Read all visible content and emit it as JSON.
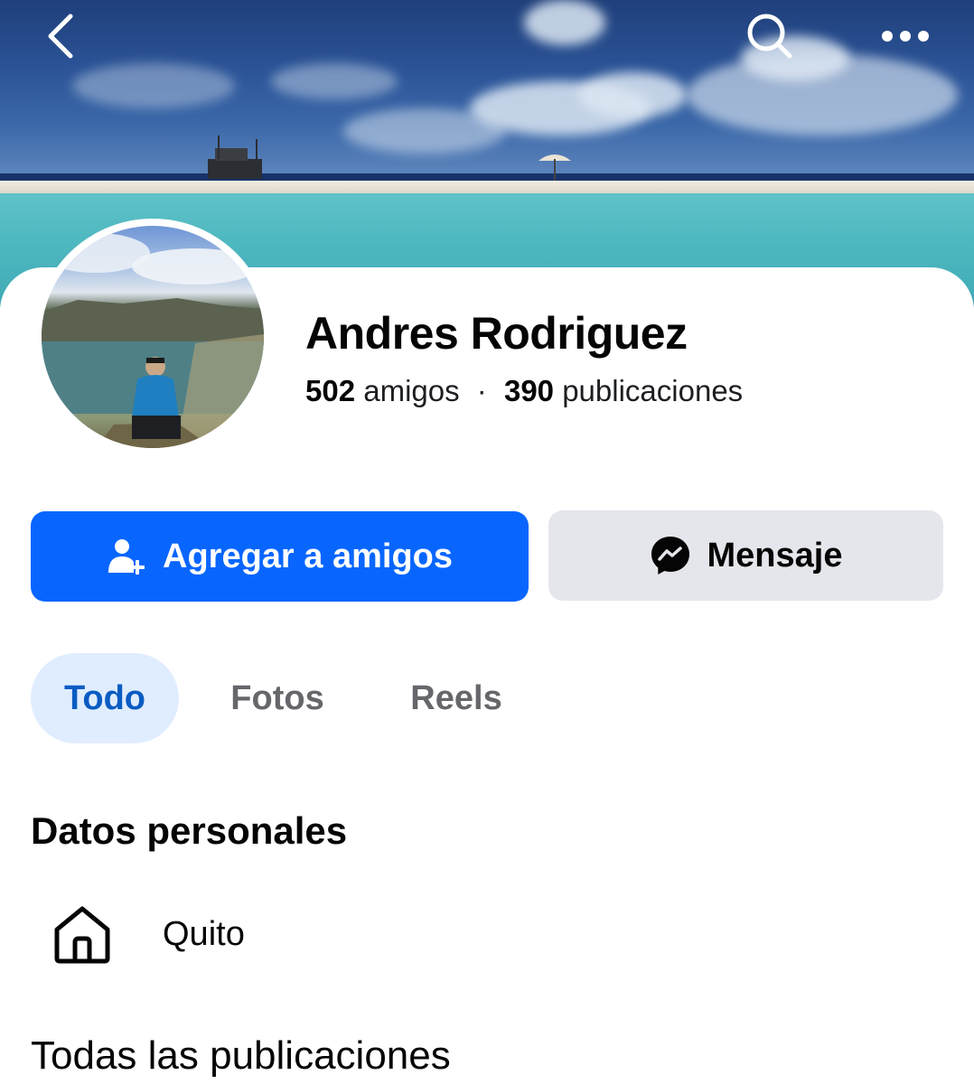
{
  "header": {
    "back_icon": "chevron-left-icon",
    "search_icon": "search-icon",
    "more_icon": "more-horizontal-icon"
  },
  "profile": {
    "name": "Andres Rodriguez",
    "friends_count": "502",
    "friends_label": "amigos",
    "separator": "·",
    "posts_count": "390",
    "posts_label": "publicaciones"
  },
  "actions": {
    "add_friend_label": "Agregar a amigos",
    "message_label": "Mensaje"
  },
  "tabs": [
    {
      "label": "Todo",
      "active": true
    },
    {
      "label": "Fotos",
      "active": false
    },
    {
      "label": "Reels",
      "active": false
    }
  ],
  "personal": {
    "title": "Datos personales",
    "city": "Quito"
  },
  "posts": {
    "title": "Todas las publicaciones"
  },
  "colors": {
    "primary": "#0866ff",
    "secondary_button": "#e4e6eb",
    "active_tab_bg": "#e0edff",
    "active_tab_text": "#0a5cc2"
  }
}
